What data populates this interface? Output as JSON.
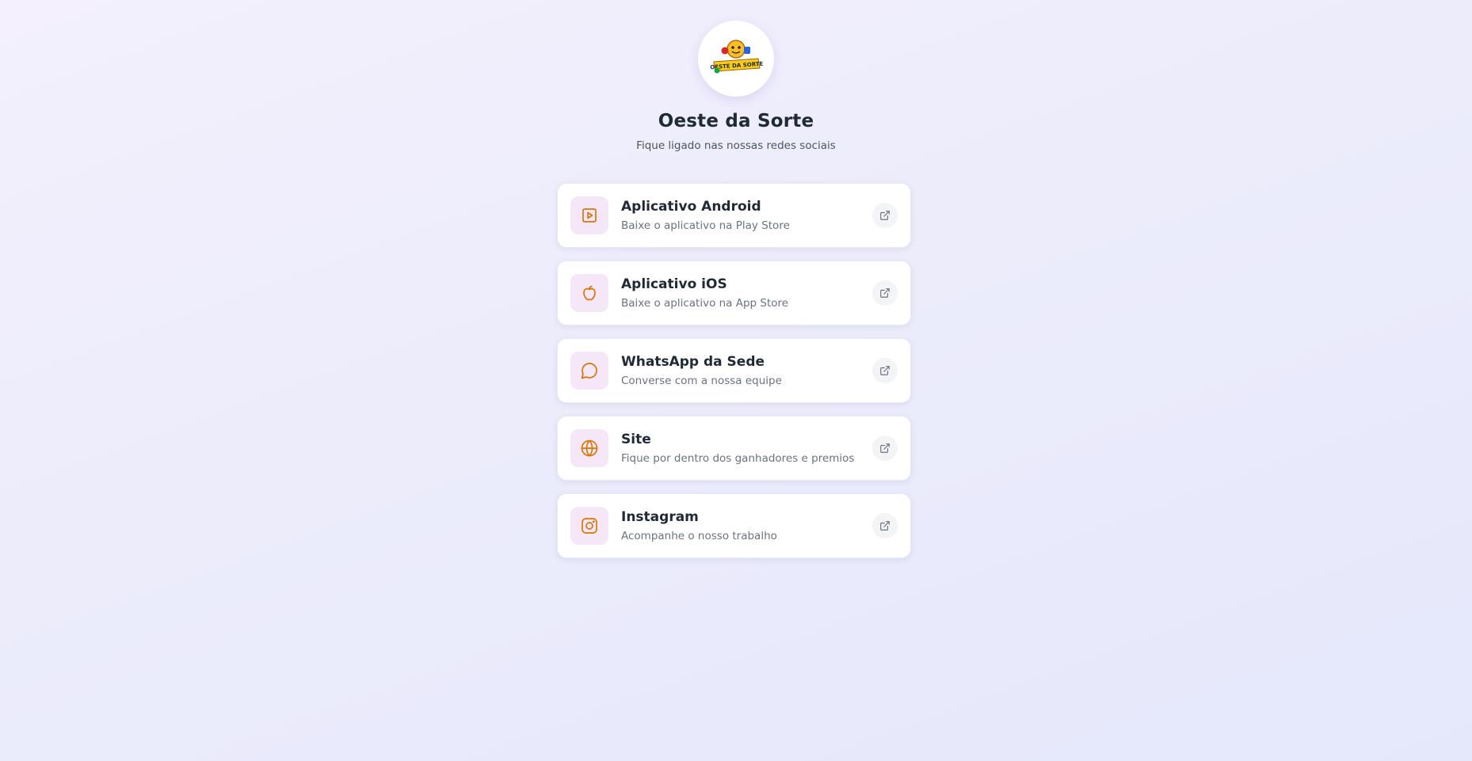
{
  "profile": {
    "logo_text": "OESTE DA SORTE",
    "name": "Oeste da Sorte",
    "tagline": "Fique ligado nas nossas redes sociais"
  },
  "colors": {
    "accent": "#d97706",
    "icon_background": "#f5e6f8",
    "title_text": "#1f2937",
    "description_text": "#6b7280"
  },
  "links": [
    {
      "icon": "play-icon",
      "title": "Aplicativo Android",
      "description": "Baixe o aplicativo na Play Store"
    },
    {
      "icon": "apple-icon",
      "title": "Aplicativo iOS",
      "description": "Baixe o aplicativo na App Store"
    },
    {
      "icon": "chat-icon",
      "title": "WhatsApp da Sede",
      "description": "Converse com a nossa equipe"
    },
    {
      "icon": "globe-icon",
      "title": "Site",
      "description": "Fique por dentro dos ganhadores e premios"
    },
    {
      "icon": "instagram-icon",
      "title": "Instagram",
      "description": "Acompanhe o nosso trabalho"
    }
  ]
}
